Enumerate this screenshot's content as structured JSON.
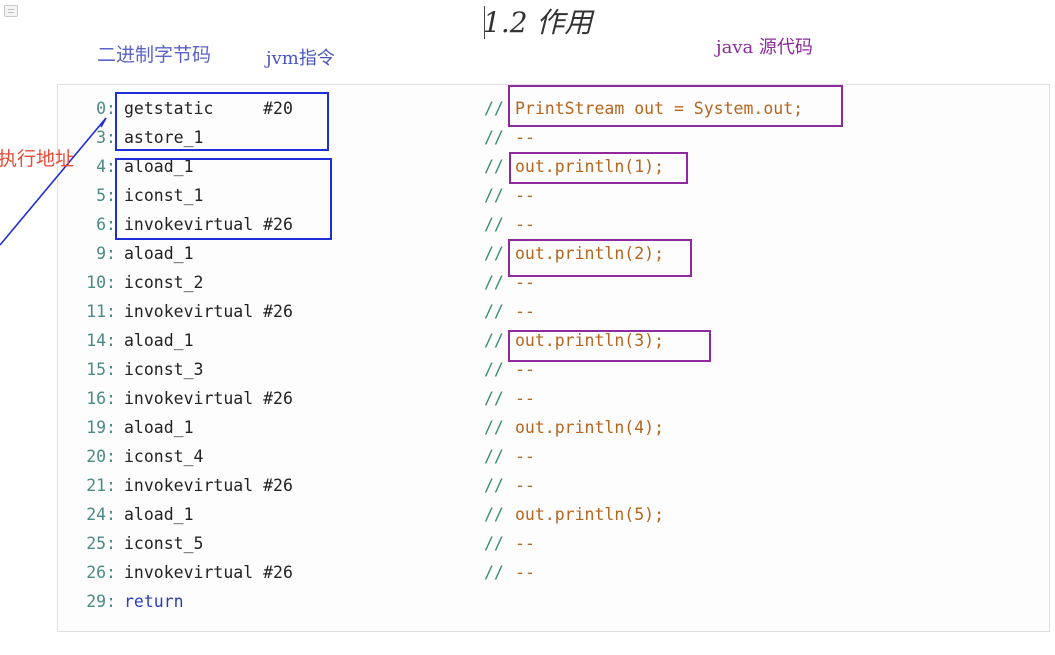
{
  "title": "1.2 作用",
  "annotations": {
    "binary_code": "二进制字节码",
    "jvm_instructions": "jvm指令",
    "java_source": "java 源代码",
    "execution_address": "执行地址"
  },
  "code": {
    "rows": [
      {
        "num": "0:",
        "instr": "getstatic     #20",
        "marker": "//",
        "comment": "PrintStream out = System.out;"
      },
      {
        "num": "3:",
        "instr": "astore_1",
        "marker": "//",
        "comment": "--"
      },
      {
        "num": "4:",
        "instr": "aload_1",
        "marker": "//",
        "comment": "out.println(1);"
      },
      {
        "num": "5:",
        "instr": "iconst_1",
        "marker": "//",
        "comment": "--"
      },
      {
        "num": "6:",
        "instr": "invokevirtual #26",
        "marker": "//",
        "comment": "--"
      },
      {
        "num": "9:",
        "instr": "aload_1",
        "marker": "//",
        "comment": "out.println(2);"
      },
      {
        "num": "10:",
        "instr": "iconst_2",
        "marker": "//",
        "comment": "--"
      },
      {
        "num": "11:",
        "instr": "invokevirtual #26",
        "marker": "//",
        "comment": "--"
      },
      {
        "num": "14:",
        "instr": "aload_1",
        "marker": "//",
        "comment": "out.println(3);"
      },
      {
        "num": "15:",
        "instr": "iconst_3",
        "marker": "//",
        "comment": "--"
      },
      {
        "num": "16:",
        "instr": "invokevirtual #26",
        "marker": "//",
        "comment": "--"
      },
      {
        "num": "19:",
        "instr": "aload_1",
        "marker": "//",
        "comment": "out.println(4);"
      },
      {
        "num": "20:",
        "instr": "iconst_4",
        "marker": "//",
        "comment": "--"
      },
      {
        "num": "21:",
        "instr": "invokevirtual #26",
        "marker": "//",
        "comment": "--"
      },
      {
        "num": "24:",
        "instr": "aload_1",
        "marker": "//",
        "comment": "out.println(5);"
      },
      {
        "num": "25:",
        "instr": "iconst_5",
        "marker": "//",
        "comment": "--"
      },
      {
        "num": "26:",
        "instr": "invokevirtual #26",
        "marker": "//",
        "comment": "--"
      },
      {
        "num": "29:",
        "instr": "return",
        "marker": "",
        "comment": ""
      }
    ]
  },
  "colors": {
    "line_number": "#4c8a85",
    "instruction": "#222222",
    "comment_marker": "#3b8d6f",
    "comment_text": "#b5651d",
    "annotation_blue": "#1e2ed6",
    "annotation_purple": "#8f2a9e",
    "annotation_red": "#e64b36"
  }
}
